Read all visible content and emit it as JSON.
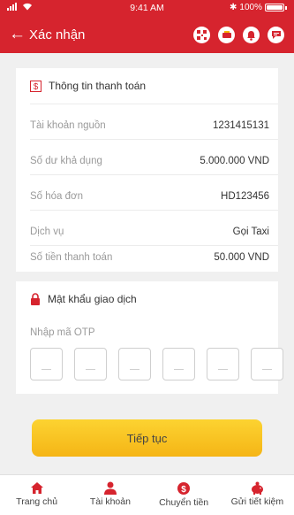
{
  "status_bar": {
    "time": "9:41 AM",
    "battery": "100%",
    "bluetooth": "✱"
  },
  "header": {
    "back_icon": "←",
    "title": "Xác nhận",
    "icons": [
      "qr-code-icon",
      "mailbox-icon",
      "bell-icon",
      "chat-icon"
    ]
  },
  "payment_info": {
    "title": "Thông tin thanh toán",
    "rows": [
      {
        "label": "Tài khoản nguồn",
        "value": "1231415131"
      },
      {
        "label": "Số dư khả dụng",
        "value": "5.000.000 VND"
      },
      {
        "label": "Số hóa đơn",
        "value": "HD123456"
      },
      {
        "label": "Dịch vụ",
        "value": "Gọi Taxi"
      },
      {
        "label": "Số tiền thanh toán",
        "value": "50.000 VND"
      }
    ]
  },
  "password": {
    "title": "Mật khẩu giao dịch",
    "otp_label": "Nhập mã OTP",
    "otp_digits": [
      "",
      "",
      "",
      "",
      "",
      ""
    ]
  },
  "continue_button": "Tiếp tục",
  "bottom_nav": [
    {
      "label": "Trang chủ",
      "icon": "home-icon"
    },
    {
      "label": "Tài khoản",
      "icon": "user-icon"
    },
    {
      "label": "Chuyển tiền",
      "icon": "money-transfer-icon"
    },
    {
      "label": "Gửi tiết kiệm",
      "icon": "piggy-bank-icon"
    }
  ],
  "colors": {
    "primary": "#d6242e",
    "button": "#f8c322",
    "background": "#f0f0f0"
  }
}
